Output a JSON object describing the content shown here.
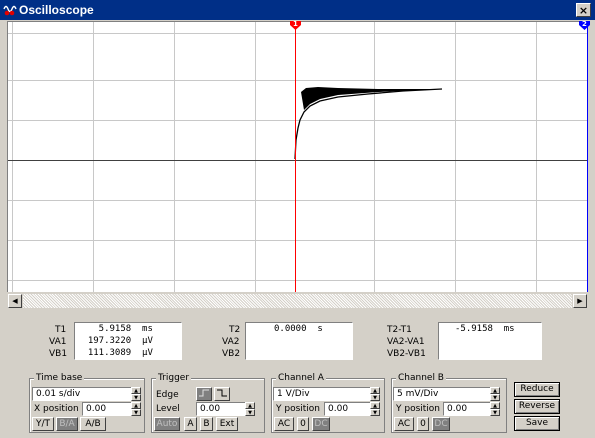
{
  "window": {
    "title": "Oscilloscope",
    "close_label": "×"
  },
  "markers": {
    "t1_label": "1",
    "t2_label": "2"
  },
  "readouts": {
    "group1": {
      "t_label": "T1",
      "va_label": "VA1",
      "vb_label": "VB1",
      "t_value": "    5.9158  ms",
      "va_value": "  197.3220  µV",
      "vb_value": "  111.3089  µV"
    },
    "group2": {
      "t_label": "T2",
      "va_label": "VA2",
      "vb_label": "VB2",
      "t_value": "0.0000  s"
    },
    "group3": {
      "t_label": "T2-T1",
      "va_label": "VA2-VA1",
      "vb_label": "VB2-VB1",
      "t_value": "-5.9158  ms"
    }
  },
  "timebase": {
    "title": "Time base",
    "scale": "0.01 s/div",
    "xpos_label": "X position",
    "xpos": "0.00",
    "modes": [
      "Y/T",
      "B/A",
      "A/B"
    ]
  },
  "trigger": {
    "title": "Trigger",
    "edge_label": "Edge",
    "level_label": "Level",
    "level": "0.00",
    "sources": [
      "Auto",
      "A",
      "B",
      "Ext"
    ]
  },
  "channel_a": {
    "title": "Channel A",
    "scale": "1  V/Div",
    "ypos_label": "Y position",
    "ypos": "0.00",
    "coupling": [
      "AC",
      "0",
      "DC"
    ]
  },
  "channel_b": {
    "title": "Channel B",
    "scale": "5 mV/Div",
    "ypos_label": "Y position",
    "ypos": "0.00",
    "coupling": [
      "AC",
      "0",
      "DC"
    ]
  },
  "actions": {
    "reduce": "Reduce",
    "reverse": "Reverse",
    "save": "Save"
  },
  "colors": {
    "titlebar": "#002f87",
    "cursor1": "#ff0000",
    "cursor2": "#0000ff",
    "trace": "#000000",
    "grid": "#c8c8c8"
  }
}
